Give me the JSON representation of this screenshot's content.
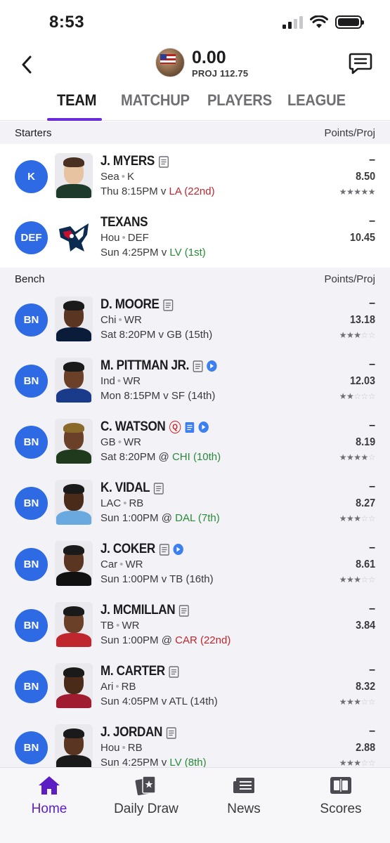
{
  "status_bar": {
    "time": "8:53"
  },
  "header": {
    "score": "0.00",
    "proj": "PROJ 112.75"
  },
  "tabs": [
    {
      "label": "TEAM",
      "active": true
    },
    {
      "label": "MATCHUP",
      "active": false
    },
    {
      "label": "PLAYERS",
      "active": false
    },
    {
      "label": "LEAGUE",
      "active": false
    }
  ],
  "starters": {
    "title": "Starters",
    "right": "Points/Proj",
    "players": [
      {
        "pos": "K",
        "name": "J. MYERS",
        "team": "Sea",
        "position": "K",
        "game": "Thu 8:15PM v ",
        "opp": "LA (22nd)",
        "opp_color": "red",
        "pts": "–",
        "proj": "8.50",
        "stars": 5
      },
      {
        "pos": "DEF",
        "name": "TEXANS",
        "team": "Hou",
        "position": "DEF",
        "game": "Sun 4:25PM v ",
        "opp": "LV (1st)",
        "opp_color": "green",
        "pts": "–",
        "proj": "10.45",
        "stars": null
      }
    ]
  },
  "bench": {
    "title": "Bench",
    "right": "Points/Proj",
    "players": [
      {
        "pos": "BN",
        "name": "D. MOORE",
        "team": "Chi",
        "position": "WR",
        "game": "Sat 8:20PM v GB (15th)",
        "opp": "",
        "opp_color": "none",
        "pts": "–",
        "proj": "13.18",
        "stars": 3
      },
      {
        "pos": "BN",
        "name": "M. PITTMAN JR.",
        "team": "Ind",
        "position": "WR",
        "game": "Mon 8:15PM v SF (14th)",
        "opp": "",
        "opp_color": "none",
        "pts": "–",
        "proj": "12.03",
        "stars": 2
      },
      {
        "pos": "BN",
        "name": "C. WATSON",
        "team": "GB",
        "position": "WR",
        "game": "Sat 8:20PM @ ",
        "opp": "CHI (10th)",
        "opp_color": "green",
        "pts": "–",
        "proj": "8.19",
        "stars": 4,
        "q": "Q"
      },
      {
        "pos": "BN",
        "name": "K. VIDAL",
        "team": "LAC",
        "position": "RB",
        "game": "Sun 1:00PM @ ",
        "opp": "DAL (7th)",
        "opp_color": "green",
        "pts": "–",
        "proj": "8.27",
        "stars": 3
      },
      {
        "pos": "BN",
        "name": "J. COKER",
        "team": "Car",
        "position": "WR",
        "game": "Sun 1:00PM v TB (16th)",
        "opp": "",
        "opp_color": "none",
        "pts": "–",
        "proj": "8.61",
        "stars": 3
      },
      {
        "pos": "BN",
        "name": "J. MCMILLAN",
        "team": "TB",
        "position": "WR",
        "game": "Sun 1:00PM @ ",
        "opp": "CAR (22nd)",
        "opp_color": "red",
        "pts": "–",
        "proj": "3.84",
        "stars": null
      },
      {
        "pos": "BN",
        "name": "M. CARTER",
        "team": "Ari",
        "position": "RB",
        "game": "Sun 4:05PM v ATL (14th)",
        "opp": "",
        "opp_color": "none",
        "pts": "–",
        "proj": "8.32",
        "stars": 3
      },
      {
        "pos": "BN",
        "name": "J. JORDAN",
        "team": "Hou",
        "position": "RB",
        "game": "Sun 4:25PM v ",
        "opp": "LV (8th)",
        "opp_color": "green",
        "pts": "–",
        "proj": "2.88",
        "stars": 3
      }
    ]
  },
  "bottom_nav": [
    {
      "label": "Home",
      "icon": "home-icon",
      "active": true
    },
    {
      "label": "Daily Draw",
      "icon": "cards-icon",
      "active": false
    },
    {
      "label": "News",
      "icon": "newspaper-icon",
      "active": false
    },
    {
      "label": "Scores",
      "icon": "scoreboard-icon",
      "active": false
    }
  ],
  "colors": {
    "accent": "#6b2bd9",
    "badge": "#2f6ae5",
    "opp_red": "#c0262d",
    "opp_green": "#2a8a3a"
  }
}
